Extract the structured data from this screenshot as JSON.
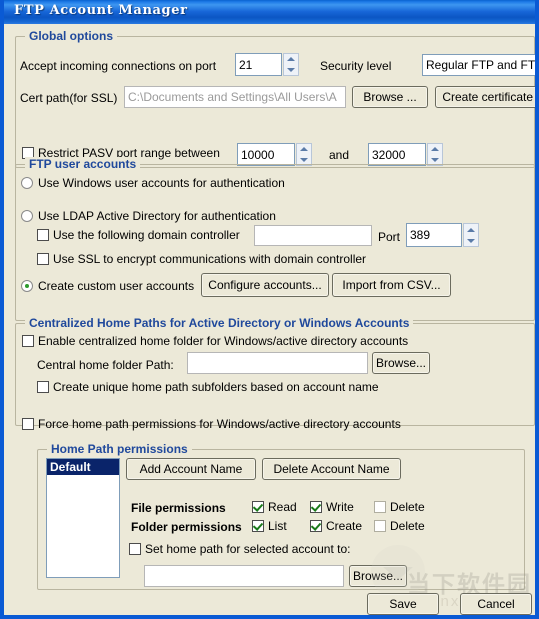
{
  "window": {
    "title": "FTP Account Manager"
  },
  "global_options": {
    "legend": "Global options",
    "accept_port_label": "Accept incoming connections on port",
    "accept_port_value": "21",
    "security_level_label": "Security level",
    "security_level_value": "Regular FTP and FTPS",
    "cert_path_label": "Cert path(for SSL)",
    "cert_path_value": "C:\\Documents and Settings\\All Users\\A",
    "browse_label": "Browse ...",
    "create_certificate_label": "Create certificate .",
    "restrict_pasv_label": "Restrict PASV port range between",
    "pasv_from": "10000",
    "and_label": "and",
    "pasv_to": "32000"
  },
  "ftp_user_accounts": {
    "legend": "FTP user accounts",
    "use_windows_accounts": "Use Windows user accounts for authentication",
    "use_ldap": "Use LDAP Active Directory for authentication",
    "use_domain_controller": "Use the following domain controller",
    "domain_controller_value": "",
    "port_label": "Port",
    "port_value": "389",
    "use_ssl": "Use SSL to encrypt communications with domain controller",
    "create_custom_accounts": "Create custom user accounts",
    "configure_accounts_label": "Configure accounts...",
    "import_csv_label": "Import from CSV..."
  },
  "centralized": {
    "legend": "Centralized Home Paths for Active Directory or Windows Accounts",
    "enable_label": "Enable centralized home folder for Windows/active directory accounts",
    "central_path_label": "Central home folder Path:",
    "central_path_value": "",
    "browse_label": "Browse...",
    "unique_subfolders_label": "Create unique home path subfolders based on account name",
    "force_permissions_label": "Force home path permissions for Windows/active directory accounts"
  },
  "home_path_permissions": {
    "legend": "Home Path permissions",
    "accounts": [
      "Default"
    ],
    "selected_account": "Default",
    "add_account_label": "Add Account Name",
    "delete_account_label": "Delete Account Name",
    "file_permissions_label": "File permissions",
    "folder_permissions_label": "Folder permissions",
    "file_read": "Read",
    "file_write": "Write",
    "file_delete": "Delete",
    "folder_list": "List",
    "folder_create": "Create",
    "folder_delete": "Delete",
    "set_home_path_label": "Set home path for selected account to:",
    "home_path_value": "",
    "browse_label": "Browse..."
  },
  "footer": {
    "save_label": "Save",
    "cancel_label": "Cancel"
  },
  "watermark": {
    "cn": "当下软件园",
    "en": "downxia.com"
  },
  "colors": {
    "title_bar": "#1766d8",
    "group_legend": "#20499c",
    "selection": "#0a246a",
    "check_mark": "#1a7a1a",
    "face": "#ece9d8"
  }
}
